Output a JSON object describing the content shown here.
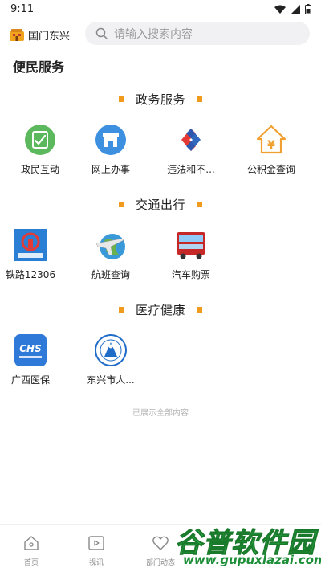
{
  "status_bar": {
    "time": "9:11"
  },
  "header": {
    "logo_text": "国门东兴",
    "search_placeholder": "请输入搜索内容"
  },
  "page_title": "便民服务",
  "sections": [
    {
      "title": "政务服务",
      "items": [
        {
          "label": "政民互动",
          "icon": "check-board-icon"
        },
        {
          "label": "网上办事",
          "icon": "storefront-icon"
        },
        {
          "label": "违法和不...",
          "icon": "report-logo-icon"
        },
        {
          "label": "公积金查询",
          "icon": "housing-fund-icon"
        }
      ]
    },
    {
      "title": "交通出行",
      "items": [
        {
          "label": "铁路12306",
          "icon": "railway-icon"
        },
        {
          "label": "航班查询",
          "icon": "airplane-globe-icon"
        },
        {
          "label": "汽车购票",
          "icon": "bus-icon"
        }
      ]
    },
    {
      "title": "医疗健康",
      "items": [
        {
          "label": "广西医保",
          "icon": "chs-medical-insurance-icon"
        },
        {
          "label": "东兴市人...",
          "icon": "hospital-emblem-icon"
        }
      ]
    }
  ],
  "end_note": "已展示全部内容",
  "bottom_nav": [
    {
      "label": "首页",
      "icon": "home-icon"
    },
    {
      "label": "视讯",
      "icon": "video-icon"
    },
    {
      "label": "部门动态",
      "icon": "heart-icon"
    }
  ],
  "watermark": {
    "title": "谷普软件园",
    "url": "www.gupuxlazai.com"
  },
  "colors": {
    "accent": "#f09a1e",
    "search_bg": "#f1f1f3",
    "watermark_green": "#2fb44a"
  }
}
